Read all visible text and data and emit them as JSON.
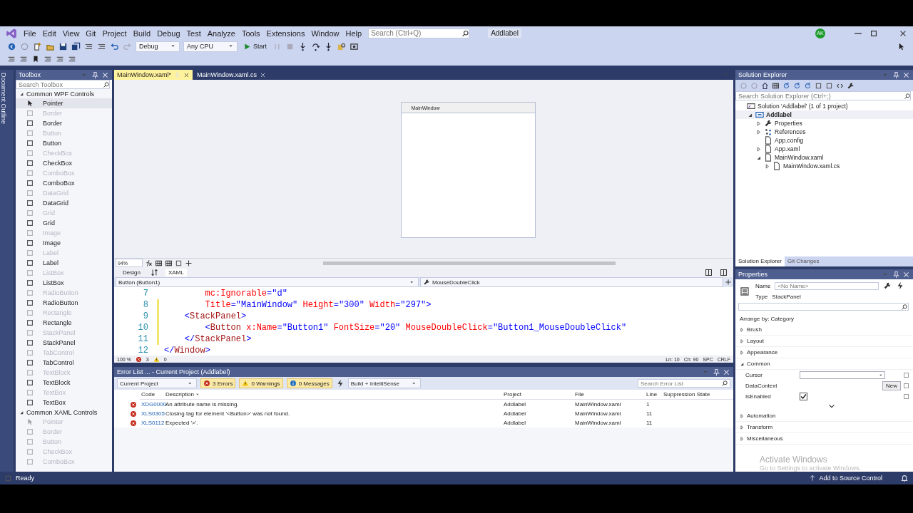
{
  "menu": [
    "File",
    "Edit",
    "View",
    "Git",
    "Project",
    "Build",
    "Debug",
    "Test",
    "Analyze",
    "Tools",
    "Extensions",
    "Window",
    "Help"
  ],
  "search": {
    "placeholder": "Search (Ctrl+Q)"
  },
  "solution_name": "Addlabel",
  "user_initials": "AK",
  "toolbar": {
    "configuration": "Debug",
    "platform": "Any CPU",
    "start": "Start"
  },
  "document_outline": "Document Outline",
  "toolbox": {
    "title": "Toolbox",
    "search_placeholder": "Search Toolbox",
    "groups": [
      {
        "title": "Common WPF Controls",
        "expanded": true,
        "items": [
          {
            "label": "Pointer",
            "disabled": false,
            "selected": true
          },
          {
            "label": "Border",
            "disabled": true,
            "selected": false
          },
          {
            "label": "Border",
            "disabled": false,
            "selected": false
          },
          {
            "label": "Button",
            "disabled": true,
            "selected": false
          },
          {
            "label": "Button",
            "disabled": false,
            "selected": false
          },
          {
            "label": "CheckBox",
            "disabled": true,
            "selected": false
          },
          {
            "label": "CheckBox",
            "disabled": false,
            "selected": false
          },
          {
            "label": "ComboBox",
            "disabled": true,
            "selected": false
          },
          {
            "label": "ComboBox",
            "disabled": false,
            "selected": false
          },
          {
            "label": "DataGrid",
            "disabled": true,
            "selected": false
          },
          {
            "label": "DataGrid",
            "disabled": false,
            "selected": false
          },
          {
            "label": "Grid",
            "disabled": true,
            "selected": false
          },
          {
            "label": "Grid",
            "disabled": false,
            "selected": false
          },
          {
            "label": "Image",
            "disabled": true,
            "selected": false
          },
          {
            "label": "Image",
            "disabled": false,
            "selected": false
          },
          {
            "label": "Label",
            "disabled": true,
            "selected": false
          },
          {
            "label": "Label",
            "disabled": false,
            "selected": false
          },
          {
            "label": "ListBox",
            "disabled": true,
            "selected": false
          },
          {
            "label": "ListBox",
            "disabled": false,
            "selected": false
          },
          {
            "label": "RadioButton",
            "disabled": true,
            "selected": false
          },
          {
            "label": "RadioButton",
            "disabled": false,
            "selected": false
          },
          {
            "label": "Rectangle",
            "disabled": true,
            "selected": false
          },
          {
            "label": "Rectangle",
            "disabled": false,
            "selected": false
          },
          {
            "label": "StackPanel",
            "disabled": true,
            "selected": false
          },
          {
            "label": "StackPanel",
            "disabled": false,
            "selected": false
          },
          {
            "label": "TabControl",
            "disabled": true,
            "selected": false
          },
          {
            "label": "TabControl",
            "disabled": false,
            "selected": false
          },
          {
            "label": "TextBlock",
            "disabled": true,
            "selected": false
          },
          {
            "label": "TextBlock",
            "disabled": false,
            "selected": false
          },
          {
            "label": "TextBox",
            "disabled": true,
            "selected": false
          },
          {
            "label": "TextBox",
            "disabled": false,
            "selected": false
          }
        ]
      },
      {
        "title": "Common XAML Controls",
        "expanded": true,
        "items": [
          {
            "label": "Pointer",
            "disabled": true,
            "selected": false
          },
          {
            "label": "Border",
            "disabled": true,
            "selected": false
          },
          {
            "label": "Button",
            "disabled": true,
            "selected": false
          },
          {
            "label": "CheckBox",
            "disabled": true,
            "selected": false
          },
          {
            "label": "ComboBox",
            "disabled": true,
            "selected": false
          }
        ]
      }
    ]
  },
  "editor_tabs": [
    {
      "label": "MainWindow.xaml*",
      "selected": true
    },
    {
      "label": "MainWindow.xaml.cs",
      "selected": false
    }
  ],
  "designer": {
    "window_title": "MainWindow",
    "zoom": "94%"
  },
  "view_tabs": [
    {
      "label": "Design",
      "selected": false
    },
    {
      "label": "XAML",
      "selected": true
    }
  ],
  "navigation": {
    "element": "Button (Button1)",
    "event": "MouseDoubleClick"
  },
  "code_lines": [
    {
      "number": "7",
      "changed": false,
      "tokens": [
        {
          "kind": "attr",
          "text": "        mc:Ignorable"
        },
        {
          "kind": "punct",
          "text": "="
        },
        {
          "kind": "value",
          "text": "\"d\""
        }
      ]
    },
    {
      "number": "8",
      "changed": true,
      "tokens": [
        {
          "kind": "attr",
          "text": "        Title"
        },
        {
          "kind": "punct",
          "text": "="
        },
        {
          "kind": "value",
          "text": "\"MainWindow\""
        },
        {
          "kind": "attr",
          "text": " Height"
        },
        {
          "kind": "punct",
          "text": "="
        },
        {
          "kind": "value",
          "text": "\"300\""
        },
        {
          "kind": "attr",
          "text": " Width"
        },
        {
          "kind": "punct",
          "text": "="
        },
        {
          "kind": "value",
          "text": "\"297\""
        },
        {
          "kind": "punct",
          "text": ">"
        }
      ]
    },
    {
      "number": "9",
      "changed": true,
      "tokens": [
        {
          "kind": "punct",
          "text": "    <"
        },
        {
          "kind": "tag",
          "text": "StackPanel"
        },
        {
          "kind": "punct",
          "text": ">"
        }
      ]
    },
    {
      "number": "10",
      "changed": true,
      "tokens": [
        {
          "kind": "punct",
          "text": "        <"
        },
        {
          "kind": "tag",
          "text": "Button"
        },
        {
          "kind": "attr",
          "text": " x:Name"
        },
        {
          "kind": "punct",
          "text": "="
        },
        {
          "kind": "value",
          "text": "\"Button1\""
        },
        {
          "kind": "attr",
          "text": " FontSize"
        },
        {
          "kind": "punct",
          "text": "="
        },
        {
          "kind": "value",
          "text": "\"20\""
        },
        {
          "kind": "attr",
          "text": " MouseDoubleClick"
        },
        {
          "kind": "punct",
          "text": "="
        },
        {
          "kind": "value",
          "text": "\"Button1_MouseDoubleClick\""
        }
      ]
    },
    {
      "number": "11",
      "changed": true,
      "tokens": [
        {
          "kind": "punct",
          "text": "    </"
        },
        {
          "kind": "tag",
          "text": "StackPanel"
        },
        {
          "kind": "punct",
          "text": ">"
        }
      ]
    },
    {
      "number": "12",
      "changed": false,
      "tokens": [
        {
          "kind": "punct",
          "text": "</"
        },
        {
          "kind": "tag",
          "text": "Window"
        },
        {
          "kind": "punct",
          "text": ">"
        }
      ]
    }
  ],
  "editor_status": {
    "zoom": "100 %",
    "errors": "3",
    "warnings": "0",
    "line": "Ln: 10",
    "column": "Ch: 90",
    "whitespace": "SPC",
    "line_ending": "CRLF"
  },
  "error_list": {
    "title": "Error List ... - Current Project (Addlabel)",
    "scope": "Current Project",
    "filters": [
      {
        "label": "3 Errors",
        "kind": "error",
        "selected": true
      },
      {
        "label": "0 Warnings",
        "kind": "warning",
        "selected": true
      },
      {
        "label": "0 Messages",
        "kind": "message",
        "selected": true
      }
    ],
    "build_filter": "Build + IntelliSense",
    "search_placeholder": "Search Error List",
    "columns": [
      "Code",
      "Description",
      "Project",
      "File",
      "Line",
      "Suppression State"
    ],
    "rows": [
      {
        "code": "XDG0000",
        "description": "An attribute name is missing.",
        "project": "Addlabel",
        "file": "MainWindow.xaml",
        "line": "1"
      },
      {
        "code": "XLS0305",
        "description": "Closing tag for element '<Button>' was not found.",
        "project": "Addlabel",
        "file": "MainWindow.xaml",
        "line": "11"
      },
      {
        "code": "XLS0112",
        "description": "Expected '>'.",
        "project": "Addlabel",
        "file": "MainWindow.xaml",
        "line": "11"
      }
    ]
  },
  "solution_explorer": {
    "title": "Solution Explorer",
    "search_placeholder": "Search Solution Explorer (Ctrl+;)",
    "tree": [
      {
        "label": "Solution 'Addlabel' (1 of 1 project)",
        "kind": "solution",
        "children": [
          {
            "label": "Addlabel",
            "kind": "project",
            "expanded": true,
            "children": [
              {
                "label": "Properties",
                "kind": "properties",
                "expanded": false
              },
              {
                "label": "References",
                "kind": "references",
                "expanded": false
              },
              {
                "label": "App.config",
                "kind": "file"
              },
              {
                "label": "App.xaml",
                "kind": "file",
                "expanded": false
              },
              {
                "label": "MainWindow.xaml",
                "kind": "file",
                "expanded": true,
                "children": [
                  {
                    "label": "MainWindow.xaml.cs",
                    "kind": "file",
                    "expanded": false
                  }
                ]
              }
            ]
          }
        ]
      }
    ],
    "tabs": [
      {
        "label": "Solution Explorer",
        "selected": true
      },
      {
        "label": "Git Changes",
        "selected": false
      }
    ]
  },
  "properties": {
    "title": "Properties",
    "name_label": "Name",
    "name_placeholder": "<No Name>",
    "type_label": "Type",
    "type": "StackPanel",
    "arrange_by": "Arrange by: Category",
    "categories": [
      {
        "label": "Brush",
        "expanded": false
      },
      {
        "label": "Layout",
        "expanded": false
      },
      {
        "label": "Appearance",
        "expanded": false
      },
      {
        "label": "Common",
        "expanded": true,
        "properties": [
          {
            "name": "Cursor",
            "kind": "dropdown"
          },
          {
            "name": "DataContext",
            "kind": "button",
            "button_label": "New"
          },
          {
            "name": "IsEnabled",
            "kind": "checkbox",
            "checked": true
          }
        ]
      },
      {
        "label": "Automation",
        "expanded": false
      },
      {
        "label": "Transform",
        "expanded": false
      },
      {
        "label": "Miscellaneous",
        "expanded": false
      }
    ]
  },
  "activation": {
    "title": "Activate Windows",
    "message": "Go to Settings to activate Windows."
  },
  "status_bar": {
    "text": "Ready",
    "source_control": "Add to Source Control"
  }
}
